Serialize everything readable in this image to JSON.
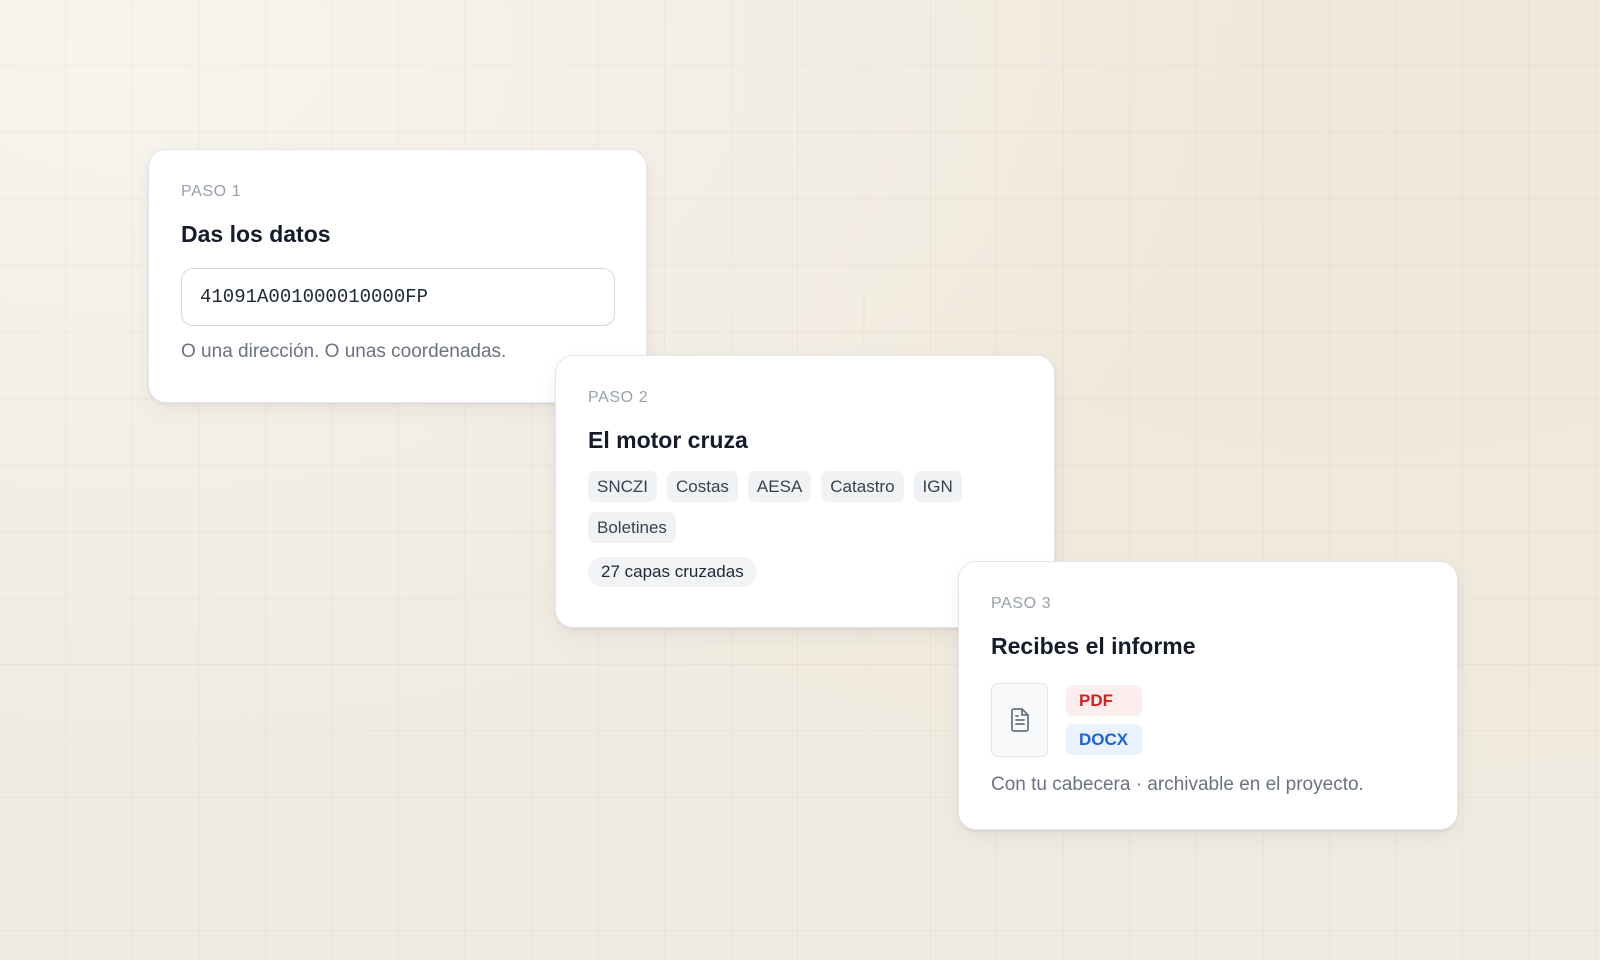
{
  "steps": [
    {
      "label": "PASO 1",
      "title": "Das los datos",
      "input_value": "41091A001000010000FP",
      "hint": "O una dirección. O unas coordenadas."
    },
    {
      "label": "PASO 2",
      "title": "El motor cruza",
      "chips": [
        "SNCZI",
        "Costas",
        "AESA",
        "Catastro",
        "IGN",
        "Boletines"
      ],
      "count": "27 capas cruzadas"
    },
    {
      "label": "PASO 3",
      "title": "Recibes el informe",
      "file_icon": "document-icon",
      "formats": [
        "PDF",
        "DOCX"
      ],
      "format_colors": {
        "PDF": "#d81e1e",
        "DOCX": "#1d63d8"
      },
      "footnote": "Con tu cabecera · archivable en el proyecto."
    }
  ]
}
